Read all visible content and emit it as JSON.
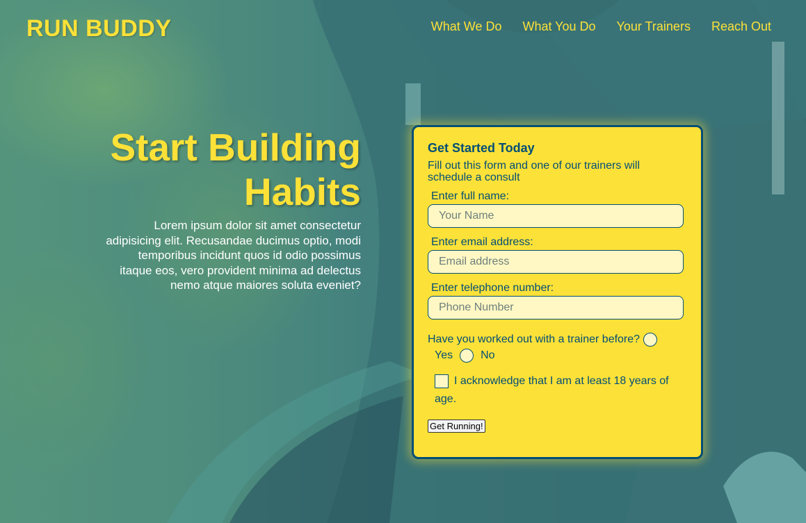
{
  "navbar": {
    "logo": "RUN BUDDY",
    "links": [
      "What We Do",
      "What You Do",
      "Your Trainers",
      "Reach Out"
    ]
  },
  "hero": {
    "title": "Start Building Habits",
    "copy": "Lorem ipsum dolor sit amet consectetur adipisicing elit. Recusandae ducimus optio, modi temporibus incidunt quos id odio possimus itaque eos, vero provident minima ad delectus nemo atque maiores soluta eveniet?"
  },
  "form": {
    "title": "Get Started Today",
    "subtitle": "Fill out this form and one of our trainers will schedule a consult",
    "name_label": "Enter full name:",
    "name_placeholder": "Your Name",
    "email_label": "Enter email address:",
    "email_placeholder": "Email address",
    "phone_label": "Enter telephone number:",
    "phone_placeholder": "Phone Number",
    "trainer_question": "Have you worked out with a trainer before?",
    "yes_label": "Yes",
    "no_label": "No",
    "ack_label": "I acknowledge that I am at least 18 years of age.",
    "submit_label": "Get Running!"
  },
  "colors": {
    "accent": "#fce138",
    "primary": "#024e76",
    "input_bg": "#fff8c4"
  }
}
